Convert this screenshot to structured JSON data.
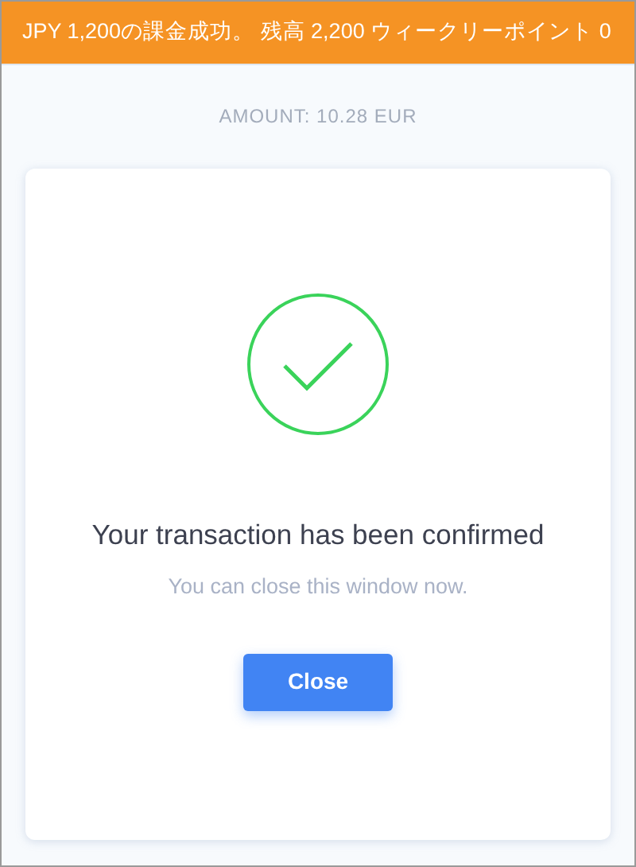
{
  "banner": {
    "text": "JPY 1,200の課金成功。 残高 2,200 ウィークリーポイント 0"
  },
  "amount": "AMOUNT: 10.28 EUR",
  "card": {
    "title": "Your transaction has been confirmed",
    "subtitle": "You can close this window now.",
    "button": "Close"
  }
}
